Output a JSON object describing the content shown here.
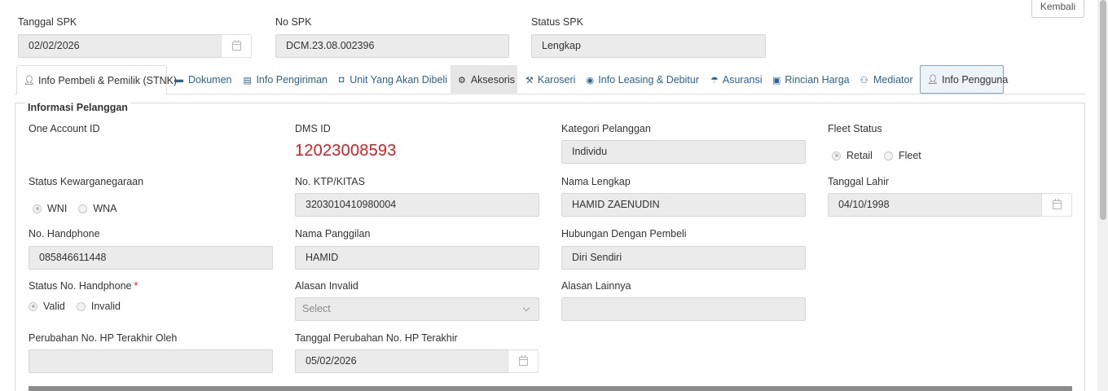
{
  "header": {
    "back_button": "Kembali",
    "tanggal_spk": {
      "label": "Tanggal SPK",
      "value": "02/02/2026"
    },
    "no_spk": {
      "label": "No SPK",
      "value": "DCM.23.08.002396"
    },
    "status_spk": {
      "label": "Status SPK",
      "value": "Lengkap"
    }
  },
  "tabs": [
    {
      "label": "Info Pembeli & Pemilik (STNK)",
      "icon": "user-icon"
    },
    {
      "label": "Dokumen",
      "icon": "folder-open-icon"
    },
    {
      "label": "Info Pengiriman",
      "icon": "map-icon"
    },
    {
      "label": "Unit Yang Akan Dibeli",
      "icon": "car-icon"
    },
    {
      "label": "Aksesoris",
      "icon": "cogs-icon"
    },
    {
      "label": "Karoseri",
      "icon": "wrench-icon"
    },
    {
      "label": "Info Leasing & Debitur",
      "icon": "eye-icon"
    },
    {
      "label": "Asuransi",
      "icon": "umbrella-icon"
    },
    {
      "label": "Rincian Harga",
      "icon": "money-icon"
    },
    {
      "label": "Mediator",
      "icon": "users-icon"
    },
    {
      "label": "Info Pengguna",
      "icon": "user-icon"
    }
  ],
  "section": {
    "title": "Informasi Pelanggan",
    "one_account_id": {
      "label": "One Account ID",
      "value": ""
    },
    "dms_id": {
      "label": "DMS ID",
      "value": "12023008593",
      "color": "#e0191f"
    },
    "kategori_pelanggan": {
      "label": "Kategori Pelanggan",
      "value": "Individu"
    },
    "fleet_status": {
      "label": "Fleet Status",
      "options": [
        "Retail",
        "Fleet"
      ],
      "selected": "Retail"
    },
    "status_kewarganegaraan": {
      "label": "Status Kewarganegaraan",
      "options": [
        "WNI",
        "WNA"
      ],
      "selected": "WNI"
    },
    "no_ktp": {
      "label": "No. KTP/KITAS",
      "value": "3203010410980004"
    },
    "nama_lengkap": {
      "label": "Nama Lengkap",
      "value": "HAMID ZAENUDIN"
    },
    "tanggal_lahir": {
      "label": "Tanggal Lahir",
      "value": "04/10/1998"
    },
    "no_handphone": {
      "label": "No. Handphone",
      "value": "085846611448"
    },
    "nama_panggilan": {
      "label": "Nama Panggilan",
      "value": "HAMID"
    },
    "hubungan": {
      "label": "Hubungan Dengan Pembeli",
      "value": "Diri Sendiri"
    },
    "status_no_hp": {
      "label": "Status No. Handphone",
      "required_mark": "*",
      "options": [
        "Valid",
        "Invalid"
      ],
      "selected": "Valid"
    },
    "alasan_invalid": {
      "label": "Alasan Invalid",
      "placeholder": "Select"
    },
    "alasan_lainnya": {
      "label": "Alasan Lainnya",
      "value": ""
    },
    "perubahan_oleh": {
      "label": "Perubahan No. HP Terakhir Oleh",
      "value": ""
    },
    "tanggal_perubahan": {
      "label": "Tanggal Perubahan No. HP Terakhir",
      "value": "05/02/2026"
    }
  }
}
